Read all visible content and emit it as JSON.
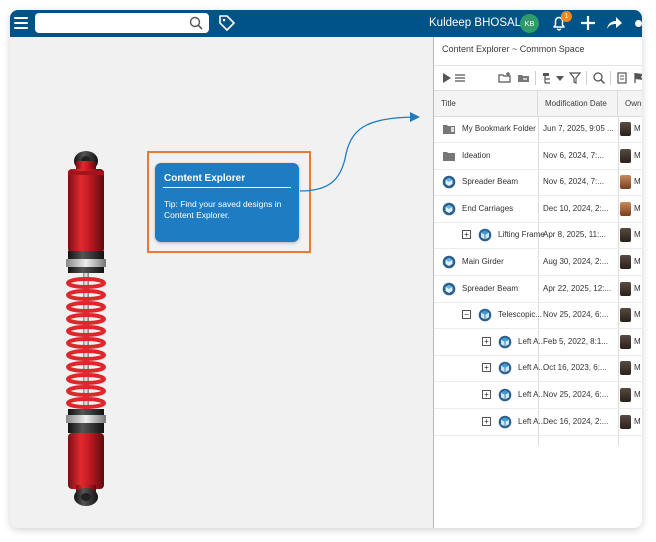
{
  "topbar": {
    "search_placeholder": "",
    "user_name": "Kuldeep BHOSALE",
    "user_initials": "KB",
    "notification_count": "1",
    "icons": [
      "menu-icon",
      "search-icon",
      "tag-icon",
      "notification-icon",
      "plus-icon",
      "share-icon"
    ]
  },
  "colors": {
    "topbar": "#005386",
    "tip_card": "#1e7cc3",
    "tip_outline": "#e87a36",
    "avatar": "#2f9a6a",
    "badge": "#f08a1c",
    "arrow": "#1e7cc3"
  },
  "tip": {
    "title": "Content Explorer",
    "text": "Tip:  Find your saved designs in Content Explorer."
  },
  "panel": {
    "title": "Content Explorer ~ Common Space",
    "columns": [
      "Title",
      "Modification Date",
      "Owne"
    ],
    "rows": [
      {
        "title": "My Bookmark Folder",
        "date": "Jun 7, 2025, 9:05 ...",
        "owner": "M",
        "icon": "bookmark-folder-icon",
        "indent": 0,
        "expand": ""
      },
      {
        "title": "Ideation",
        "date": "Nov 6, 2024, 7:...",
        "owner": "M",
        "icon": "folder-icon",
        "indent": 0,
        "expand": ""
      },
      {
        "title": "Spreader Beam",
        "date": "Nov 6, 2024, 7:...",
        "owner": "M",
        "icon": "part-icon",
        "indent": 0,
        "expand": ""
      },
      {
        "title": "End Carriages",
        "date": "Dec 10, 2024, 2:...",
        "owner": "M",
        "icon": "part-icon",
        "indent": 0,
        "expand": ""
      },
      {
        "title": "Lifting Frame",
        "date": "Apr 8, 2025, 11:...",
        "owner": "M",
        "icon": "assembly-icon",
        "indent": 1,
        "expand": "+"
      },
      {
        "title": "Main Girder",
        "date": "Aug 30, 2024, 2:...",
        "owner": "M",
        "icon": "part-icon",
        "indent": 0,
        "expand": ""
      },
      {
        "title": "Spreader Beam",
        "date": "Apr 22, 2025, 12:...",
        "owner": "M",
        "icon": "part-icon",
        "indent": 0,
        "expand": ""
      },
      {
        "title": "Telescopic...",
        "date": "Nov 25, 2024, 6:...",
        "owner": "M",
        "icon": "assembly-icon",
        "indent": 1,
        "expand": "−"
      },
      {
        "title": "Left A...",
        "date": "Feb 5, 2022, 8:1...",
        "owner": "M",
        "icon": "assembly-icon",
        "indent": 2,
        "expand": "+"
      },
      {
        "title": "Left A...",
        "date": "Oct 16, 2023, 6:...",
        "owner": "M",
        "icon": "assembly-icon",
        "indent": 2,
        "expand": "+"
      },
      {
        "title": "Left A...",
        "date": "Nov 25, 2024, 6:...",
        "owner": "M",
        "icon": "assembly-icon",
        "indent": 2,
        "expand": "+"
      },
      {
        "title": "Left A...",
        "date": "Dec 16, 2024, 2:...",
        "owner": "M",
        "icon": "assembly-icon",
        "indent": 2,
        "expand": "+"
      }
    ]
  }
}
